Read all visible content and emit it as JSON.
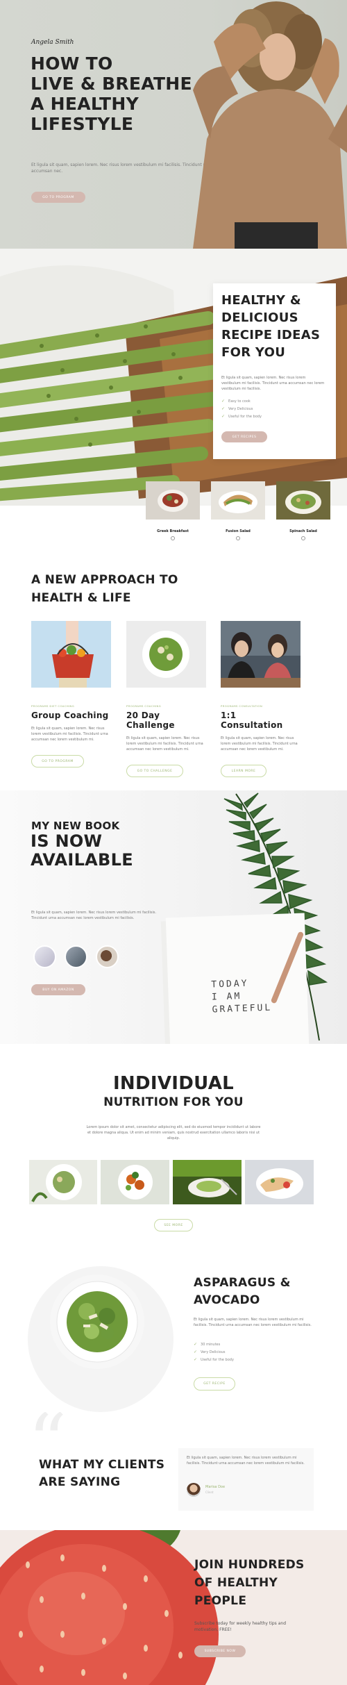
{
  "hero": {
    "signature": "Angela Smith",
    "title_lines": [
      "HOW TO",
      "LIVE & BREATHE",
      "A HEALTHY",
      "LIFESTYLE"
    ],
    "text": "Et ligula sit quam, sapien lorem. Nec risus lorem vestibulum mi facilisis. Tincidunt urna accumsan nec.",
    "button": "GO TO PROGRAM"
  },
  "recipes": {
    "title_lines": [
      "HEALTHY &",
      "DELICIOUS",
      "RECIPE IDEAS",
      "FOR YOU"
    ],
    "text": "Et ligula sit quam, sapien lorem. Nec risus lorem vestibulum mi facilisis. Tincidunt urna accumsan nec lorem vestibulum mi facilisis.",
    "checks": [
      "Easy to cook",
      "Very Delicious",
      "Useful for the body"
    ],
    "button": "GET RECIPES",
    "thumbs": [
      "Greek Breakfast",
      "Fusion Salad",
      "Spinach Salad"
    ]
  },
  "approach": {
    "title_lines": [
      "A NEW APPROACH TO",
      "HEALTH & LIFE"
    ],
    "cards": [
      {
        "tags": "PROGRAMS    DIET    COACHING",
        "title": "Group Coaching",
        "text": "Et ligula sit quam, sapien lorem. Nec risus lorem vestibulum mi facilisis. Tincidunt urna accumsan nec lorem vestibulum mi.",
        "button": "GO TO PROGRAM"
      },
      {
        "tags": "PROGRAMS    COACHING",
        "title": "20 Day Challenge",
        "text": "Et ligula sit quam, sapien lorem. Nec risus lorem vestibulum mi facilisis. Tincidunt urna accumsan nec lorem vestibulum mi.",
        "button": "GO TO CHALLENGE"
      },
      {
        "tags": "PROGRAMS    CONSULTATION",
        "title": "1:1 Consultation",
        "text": "Et ligula sit quam, sapien lorem. Nec risus lorem vestibulum mi facilisis. Tincidunt urna accumsan nec lorem vestibulum mi.",
        "button": "LEARN MORE"
      }
    ]
  },
  "book": {
    "subtitle": "MY NEW BOOK",
    "title_lines": [
      "IS NOW",
      "AVAILABLE"
    ],
    "text": "Et ligula sit quam, sapien lorem. Nec risus lorem vestibulum mi facilisis. Tincidunt urna accumsan nec lorem vestibulum mi facilisis.",
    "button": "BUY ON AMAZON",
    "cover_lines": [
      "TODAY",
      "I AM",
      "GRATEFUL"
    ]
  },
  "nutrition": {
    "title": "INDIVIDUAL",
    "subtitle": "NUTRITION FOR YOU",
    "text": "Lorem ipsum dolor sit amet, consectetur adipiscing elit, sed do eiusmod tempor incididunt ut labore et dolore magna aliqua. Ut enim ad minim veniam, quis nostrud exercitation ullamco laboris nisi ut aliquip.",
    "button": "SEE MORE"
  },
  "asparagus": {
    "title_lines": [
      "ASPARAGUS &",
      "AVOCADO"
    ],
    "text": "Et ligula sit quam, sapien lorem. Nec risus lorem vestibulum mi facilisis. Tincidunt urna accumsan nec lorem vestibulum mi facilisis.",
    "checks": [
      "30 minutes",
      "Very Delicious",
      "Useful for the body"
    ],
    "button": "GET RECIPE"
  },
  "clients": {
    "title_lines": [
      "WHAT MY CLIENTS",
      "ARE SAYING"
    ],
    "quote": "Et ligula sit quam, sapien lorem. Nec risus lorem vestibulum mi facilisis. Tincidunt urna accumsan nec lorem vestibulum mi facilisis.",
    "name": "Marisa Doe",
    "role": "Client"
  },
  "join": {
    "title_lines": [
      "JOIN HUNDREDS",
      "OF HEALTHY",
      "PEOPLE"
    ],
    "text": "Subscribe today for weekly healthy tips and motivation, FREE!",
    "button": "SUBSCRIBE NOW"
  }
}
